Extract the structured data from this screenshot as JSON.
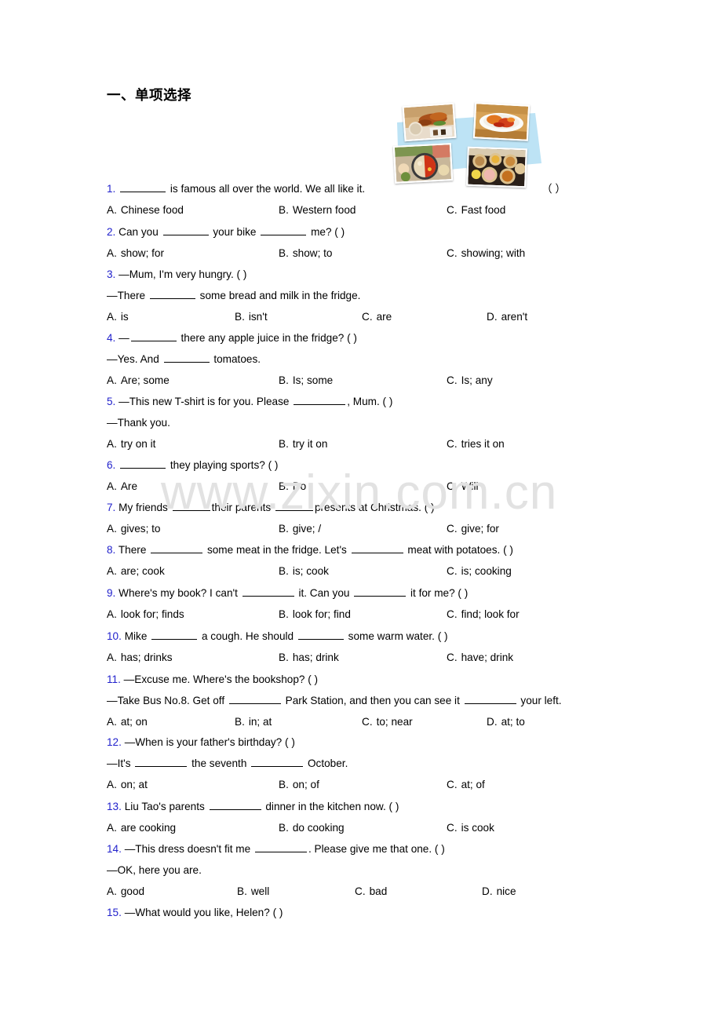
{
  "section": {
    "title": "一、单项选择"
  },
  "watermark": {
    "text": "www.zixin.com.cn"
  },
  "illustration": {
    "name": "chinese-food-photo-collage",
    "banner_color": "#bde3f5",
    "photos": [
      {
        "alt": "peking-duck"
      },
      {
        "alt": "sweet-and-sour-dish"
      },
      {
        "alt": "hot-pot"
      },
      {
        "alt": "dim-sum-steamer-baskets"
      }
    ]
  },
  "questions": [
    {
      "num": "1.",
      "stem_a": "is famous all over the world. We all like it.",
      "trailing_paren": "（ ）",
      "options": [
        {
          "label": "A.",
          "text": "Chinese food"
        },
        {
          "label": "B.",
          "text": "Western food"
        },
        {
          "label": "C.",
          "text": "Fast food"
        }
      ]
    },
    {
      "num": "2.",
      "stem_a": "Can you",
      "stem_b": "your bike",
      "stem_c": "me? (    )",
      "options": [
        {
          "label": "A.",
          "text": "show; for"
        },
        {
          "label": "B.",
          "text": "show; to"
        },
        {
          "label": "C.",
          "text": "showing; with"
        }
      ]
    },
    {
      "num": "3.",
      "stem_a": "—Mum, I'm very hungry. (  )",
      "line2_a": "—There",
      "line2_b": "some bread and milk in the fridge.",
      "options": [
        {
          "label": "A.",
          "text": "is"
        },
        {
          "label": "B.",
          "text": "isn't"
        },
        {
          "label": "C.",
          "text": "are"
        },
        {
          "label": "D.",
          "text": "aren't"
        }
      ]
    },
    {
      "num": "4.",
      "stem_a": "—",
      "stem_b": "there any apple juice in the fridge? (    )",
      "line2_a": "—Yes. And",
      "line2_b": "tomatoes.",
      "options": [
        {
          "label": "A.",
          "text": "Are; some"
        },
        {
          "label": "B.",
          "text": "Is; some"
        },
        {
          "label": "C.",
          "text": "Is; any"
        }
      ]
    },
    {
      "num": "5.",
      "stem_a": "—This new T-shirt is for you. Please",
      "stem_b": ", Mum. (    )",
      "line2_a": "—Thank you.",
      "options": [
        {
          "label": "A.",
          "text": "try on it"
        },
        {
          "label": "B.",
          "text": "try it on"
        },
        {
          "label": "C.",
          "text": "tries it on"
        }
      ]
    },
    {
      "num": "6.",
      "stem_a": "they playing sports? (  )",
      "options": [
        {
          "label": "A.",
          "text": "Are"
        },
        {
          "label": "B.",
          "text": "Do"
        },
        {
          "label": "C.",
          "text": "Will"
        }
      ]
    },
    {
      "num": "7.",
      "stem_a": "My friends",
      "stem_b": "their parents",
      "stem_c": "presents at Christmas. (  )",
      "options": [
        {
          "label": "A.",
          "text": "gives; to"
        },
        {
          "label": "B.",
          "text": "give; /"
        },
        {
          "label": "C.",
          "text": "give; for"
        }
      ]
    },
    {
      "num": "8.",
      "stem_a": "There",
      "stem_b": "some meat in the fridge. Let's",
      "stem_c": "meat with potatoes. (  )",
      "options": [
        {
          "label": "A.",
          "text": "are; cook"
        },
        {
          "label": "B.",
          "text": "is; cook"
        },
        {
          "label": "C.",
          "text": "is; cooking"
        }
      ]
    },
    {
      "num": "9.",
      "stem_a": "Where's my book? I can't",
      "stem_b": "it. Can you",
      "stem_c": "it for me? (  )",
      "options": [
        {
          "label": "A.",
          "text": "look for; finds"
        },
        {
          "label": "B.",
          "text": "look for; find"
        },
        {
          "label": "C.",
          "text": "find; look for"
        }
      ]
    },
    {
      "num": "10.",
      "stem_a": "Mike",
      "stem_b": "a cough. He should",
      "stem_c": "some warm water. (  )",
      "options": [
        {
          "label": "A.",
          "text": "has; drinks"
        },
        {
          "label": "B.",
          "text": "has; drink"
        },
        {
          "label": "C.",
          "text": "have; drink"
        }
      ]
    },
    {
      "num": "11.",
      "stem_a": "—Excuse me. Where's the bookshop? (  )",
      "line2_a": "—Take Bus No.8. Get off",
      "line2_b": "Park Station, and then you can see it",
      "line2_c": "your left.",
      "options": [
        {
          "label": "A.",
          "text": "at; on"
        },
        {
          "label": "B.",
          "text": "in; at"
        },
        {
          "label": "C.",
          "text": "to; near"
        },
        {
          "label": "D.",
          "text": "at; to"
        }
      ]
    },
    {
      "num": "12.",
      "stem_a": "—When is your father's birthday? (  )",
      "line2_a": "—It's",
      "line2_b": "the seventh",
      "line2_c": "October.",
      "options": [
        {
          "label": "A.",
          "text": "on; at"
        },
        {
          "label": "B.",
          "text": "on; of"
        },
        {
          "label": "C.",
          "text": "at; of"
        }
      ]
    },
    {
      "num": "13.",
      "stem_a": "Liu Tao's parents",
      "stem_b": "dinner in the kitchen now. (  )",
      "options": [
        {
          "label": "A.",
          "text": "are cooking"
        },
        {
          "label": "B.",
          "text": "do cooking"
        },
        {
          "label": "C.",
          "text": "is cook"
        }
      ]
    },
    {
      "num": "14.",
      "stem_a": "—This dress doesn't fit me",
      "stem_b": ". Please give me that one. (  )",
      "line2_a": "—OK, here you are.",
      "options": [
        {
          "label": "A.",
          "text": "good"
        },
        {
          "label": "B.",
          "text": "well"
        },
        {
          "label": "C.",
          "text": "bad"
        },
        {
          "label": "D.",
          "text": "nice"
        }
      ]
    },
    {
      "num": "15.",
      "stem_a": "—What would you like, Helen? (    )",
      "options": []
    }
  ]
}
